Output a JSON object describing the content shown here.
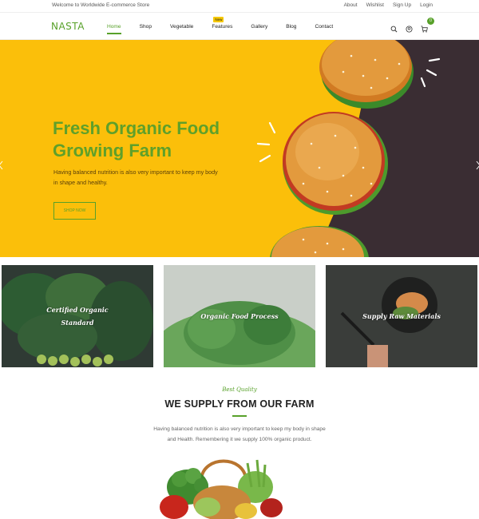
{
  "topbar": {
    "welcome": "Welcome to Worldwide E-commerce Store",
    "links": [
      "About",
      "Wishlist",
      "Sign Up",
      "Login"
    ]
  },
  "header": {
    "logo": "NASTA",
    "nav": [
      {
        "label": "Home",
        "active": true
      },
      {
        "label": "Shop"
      },
      {
        "label": "Vegetable"
      },
      {
        "label": "Features",
        "badge": "New"
      },
      {
        "label": "Gallery"
      },
      {
        "label": "Blog"
      },
      {
        "label": "Contact"
      }
    ],
    "icons": [
      "search-icon",
      "user-icon",
      "cart-icon"
    ],
    "cart_count": "0"
  },
  "hero": {
    "title_line1": "Fresh Organic Food",
    "title_line2": "Growing Farm",
    "description_line1": "Having balanced nutrition is also very important to keep my body",
    "description_line2": "in shape and healthy.",
    "button": "SHOP NOW"
  },
  "cards": [
    {
      "line1": "Certified Organic",
      "line2": "Standard"
    },
    {
      "line1": "Organic Food Process",
      "line2": ""
    },
    {
      "line1": "Supply Raw Materials",
      "line2": ""
    }
  ],
  "supply": {
    "kicker": "Best Quality",
    "title": "WE SUPPLY FROM OUR FARM",
    "description_line1": "Having balanced nutrition is also very important to keep my body in shape",
    "description_line2": "and Health. Remembering it we supply 100% organic product."
  },
  "colors": {
    "brand_green": "#58a12a",
    "hero_yellow": "#fbbf0a",
    "hero_dark": "#3a2d33",
    "badge_yellow": "#f6c800"
  }
}
